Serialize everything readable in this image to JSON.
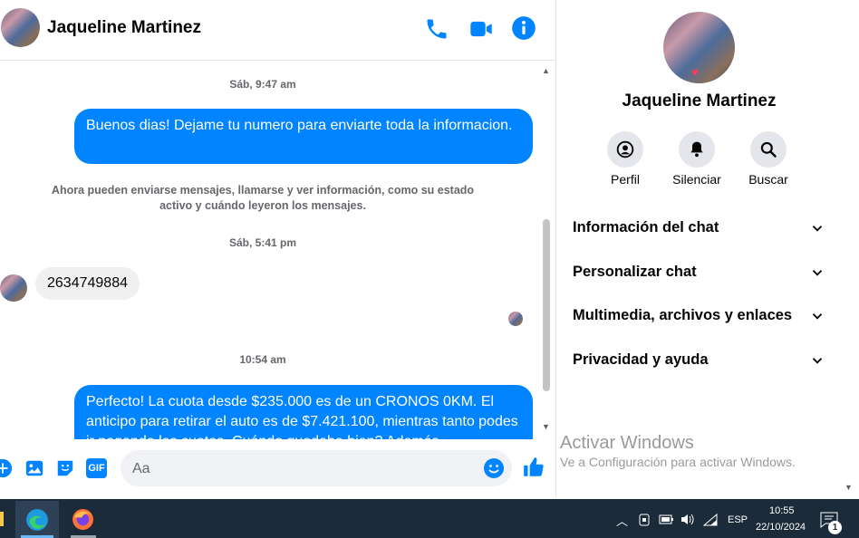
{
  "header": {
    "contact_name": "Jaqueline Martinez"
  },
  "messages": {
    "ts1": "Sáb, 9:47 am",
    "out1": "Buenos dias! Dejame tu numero para enviarte toda la informacion.",
    "system": "Ahora pueden enviarse mensajes, llamarse y ver información, como su estado activo y cuándo leyeron los mensajes.",
    "ts2": "Sáb, 5:41 pm",
    "in1": "2634749884",
    "ts3": "10:54 am",
    "out2": "Perfecto! La cuota desde $235.000 es de un CRONOS 0KM. El anticipo para retirar el auto es de $7.421.100, mientras tanto podes ir pagando las cuotas. Cuándo quedaba bien? Además"
  },
  "composer": {
    "placeholder": "Aa",
    "gif_label": "GIF"
  },
  "side": {
    "name": "Jaqueline Martinez",
    "actions": [
      {
        "label": "Perfil",
        "icon": "profile-icon"
      },
      {
        "label": "Silenciar",
        "icon": "bell-icon"
      },
      {
        "label": "Buscar",
        "icon": "search-icon"
      }
    ],
    "sections": [
      "Información del chat",
      "Personalizar chat",
      "Multimedia, archivos y enlaces",
      "Privacidad y ayuda"
    ]
  },
  "watermark": {
    "line1": "Activar Windows",
    "line2": "Ve a Configuración para activar Windows."
  },
  "taskbar": {
    "lang": "ESP",
    "time": "10:55",
    "date": "22/10/2024",
    "notif_count": "1"
  },
  "colors": {
    "accent": "#0084ff",
    "taskbar": "#1c2b3a"
  }
}
